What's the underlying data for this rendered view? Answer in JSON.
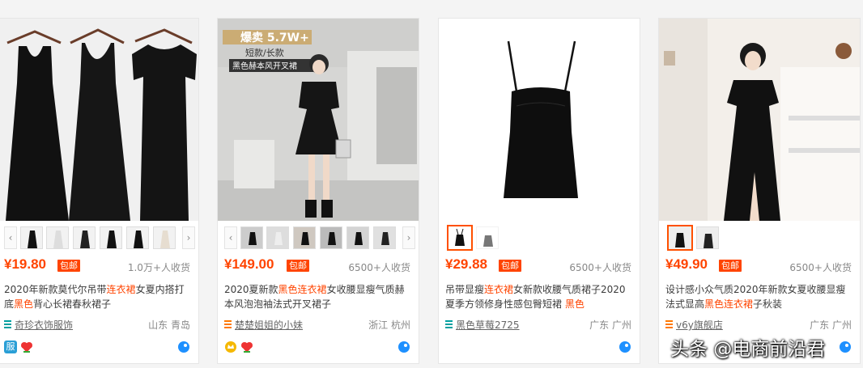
{
  "products": [
    {
      "price": "¥19.80",
      "badge": "包邮",
      "sales": "1.0万+人收货",
      "title_parts": [
        "2020年新款莫代尔吊带",
        "连衣裙",
        "女夏内搭打底",
        "黑色",
        "背心长裙春秋裙子"
      ],
      "shop": "奇珍衣饰服饰",
      "location": "山东 青岛",
      "icon_names": [
        "shop-list-icon",
        "service-icon-fu",
        "heart-flower-icon",
        "wangwang-chat-icon"
      ]
    },
    {
      "price": "¥149.00",
      "badge": "包邮",
      "sales": "6500+人收货",
      "title_parts": [
        "2020夏新款",
        "黑色连衣裙",
        "女收腰显瘦气质赫本风泡泡袖法式开叉裙子"
      ],
      "shop": "楚楚姐姐的小妹",
      "location": "浙江 杭州",
      "photo_caption_top": "爆卖 5.7W+",
      "photo_caption_mid": "短款/长款",
      "photo_caption_bot": "黑色赫本风开叉裙",
      "icon_names": [
        "shop-list-icon",
        "gold-crown-icon",
        "heart-flower-icon",
        "wangwang-chat-icon"
      ]
    },
    {
      "price": "¥29.88",
      "badge": "包邮",
      "sales": "6500+人收货",
      "title_parts": [
        "吊带显瘦",
        "连衣裙",
        "女新款收腰气质裙子2020夏季方领修身性感包臀短裙 ",
        "黑色"
      ],
      "shop": "黑色草莓2725",
      "location": "广东 广州",
      "icon_names": [
        "shop-list-icon",
        "wangwang-chat-icon"
      ]
    },
    {
      "price": "¥49.90",
      "badge": "包邮",
      "sales": "6500+人收货",
      "title_parts": [
        "设计感小众气质2020年新款女夏收腰显瘦法式显高",
        "黑色连衣裙",
        "子秋装"
      ],
      "shop": "v6y旗舰店",
      "location": "广东 广州",
      "icon_names": [
        "shop-list-icon",
        "wangwang-chat-icon"
      ]
    }
  ],
  "watermark": "头条 @电商前沿君",
  "colors": {
    "accent": "#ff4400",
    "shop_icon": "#00a0a0",
    "shop_icon_alt": "#ff7800"
  }
}
